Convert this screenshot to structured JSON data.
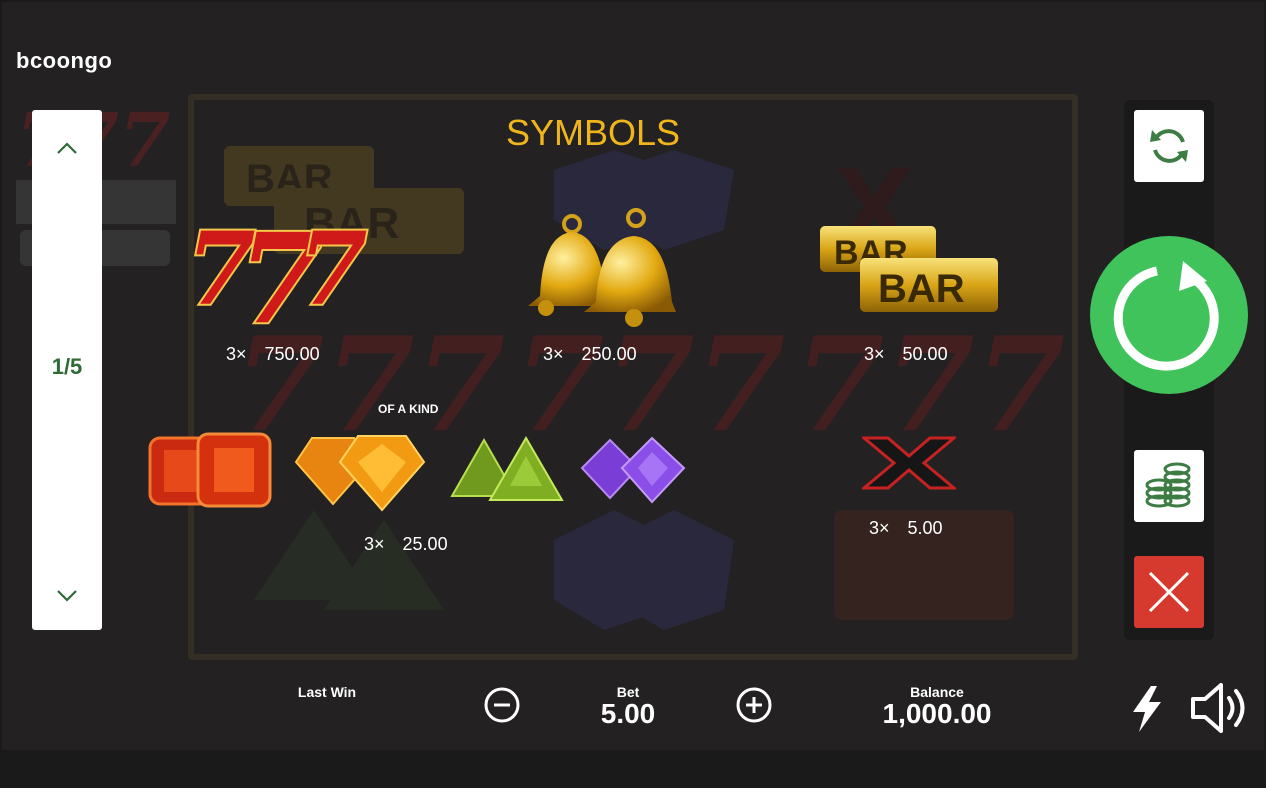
{
  "brand": {
    "logo_text": "bcoongo"
  },
  "paytable": {
    "title": "SYMBOLS",
    "page_indicator": "1/5",
    "of_a_kind_label": "OF A KIND",
    "entries": [
      {
        "symbol": "seven-7-7",
        "multiplier": "3×",
        "payout": "750.00"
      },
      {
        "symbol": "bells",
        "multiplier": "3×",
        "payout": "250.00"
      },
      {
        "symbol": "bar-bar",
        "multiplier": "3×",
        "payout": "50.00"
      },
      {
        "symbol": "gems",
        "multiplier": "3×",
        "payout": "25.00"
      },
      {
        "symbol": "x",
        "multiplier": "3×",
        "payout": "5.00"
      }
    ]
  },
  "bottom_bar": {
    "last_win_label": "Last Win",
    "bet_label": "Bet",
    "bet_value": "5.00",
    "balance_label": "Balance",
    "balance_value": "1,000.00"
  },
  "background_symbols": {
    "bar_text": "BAR",
    "x_text": "X"
  },
  "bar_text": "BAR",
  "icons": {
    "autoplay": "autoplay-icon",
    "spin": "spin-icon",
    "bet_stack": "coins-icon",
    "close": "close-icon",
    "turbo": "lightning-icon",
    "sound": "speaker-icon",
    "bet_decrease": "minus-icon",
    "bet_increase": "plus-icon",
    "page_up": "chevron-up-icon",
    "page_down": "chevron-down-icon"
  },
  "colors": {
    "title": "#f0b51a",
    "spin_button": "#3fc35a",
    "close_button": "#d63a2e",
    "panel_icon": "#3d7d44",
    "pager_text": "#2f6b36"
  }
}
